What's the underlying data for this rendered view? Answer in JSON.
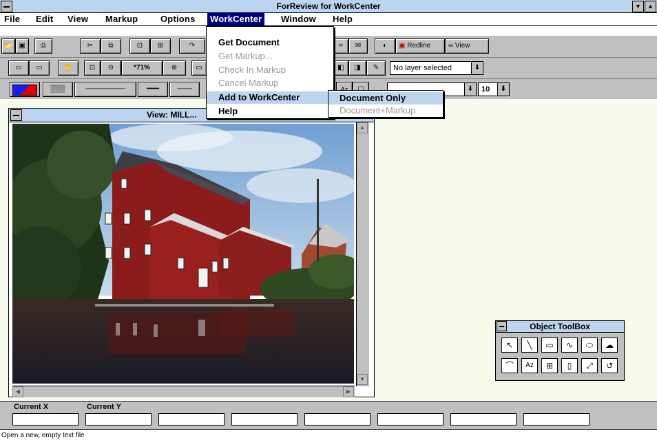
{
  "window": {
    "title": "ForReview for WorkCenter"
  },
  "menubar": {
    "items": [
      {
        "label": "File"
      },
      {
        "label": "Edit"
      },
      {
        "label": "View"
      },
      {
        "label": "Markup"
      },
      {
        "label": "Options"
      },
      {
        "label": "WorkCenter"
      },
      {
        "label": "Window"
      },
      {
        "label": "Help"
      }
    ]
  },
  "workcenter_menu": {
    "items": [
      {
        "label": "Get Document",
        "enabled": true
      },
      {
        "label": "Get Markup...",
        "enabled": false
      },
      {
        "label": "Check In Markup",
        "enabled": false
      },
      {
        "label": "Cancel Markup",
        "enabled": false
      },
      {
        "label": "Add to WorkCenter",
        "enabled": true
      },
      {
        "label": "Help",
        "enabled": true
      }
    ]
  },
  "submenu": {
    "items": [
      {
        "label": "Document Only",
        "enabled": true
      },
      {
        "label": "Document+Markup",
        "enabled": false
      }
    ]
  },
  "toolbar1": {
    "redline_label": "Redline",
    "view_label": "View"
  },
  "toolbar2": {
    "zoom_label": "*71%",
    "layer_select": "No layer selected"
  },
  "toolbar3": {
    "font_size": "10"
  },
  "view_window": {
    "title": "View: MILL..."
  },
  "toolbox": {
    "title": "Object ToolBox"
  },
  "coords": {
    "x_label": "Current X",
    "y_label": "Current Y"
  },
  "status": {
    "text": "Open a new, empty text file"
  },
  "colors": {
    "titlebar": "#bcd4f0",
    "workspace": "#f6fbee",
    "chrome": "#c0c0c0",
    "highlight": "#000080"
  }
}
